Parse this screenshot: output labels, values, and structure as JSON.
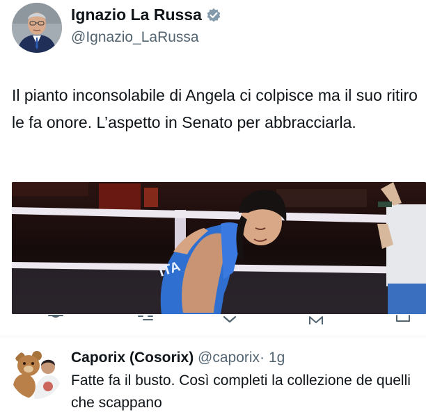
{
  "tweet": {
    "author_name": "Ignazio La Russa",
    "author_handle": "@Ignazio_LaRussa",
    "text": "Il pianto inconsolabile di Angela ci colpisce ma il suo ritiro le fa onore. L’aspetto in Senato per abbracciarla.",
    "jersey_text": "ITA",
    "colors": {
      "verified_badge": "#829aab",
      "jersey": "#2f6fd0",
      "ring_rope": "#ede8f0"
    }
  },
  "actions": [
    {
      "icon": "reply-icon"
    },
    {
      "icon": "retweet-icon"
    },
    {
      "icon": "like-icon"
    },
    {
      "icon": "views-icon"
    },
    {
      "icon": "share-icon"
    }
  ],
  "reply": {
    "author_name": "Caporix (Cosorix)",
    "author_handle": "@caporix",
    "time": "· 1g",
    "text": "Fatte fa il busto. Così completi la collezione de quelli che scappano"
  }
}
